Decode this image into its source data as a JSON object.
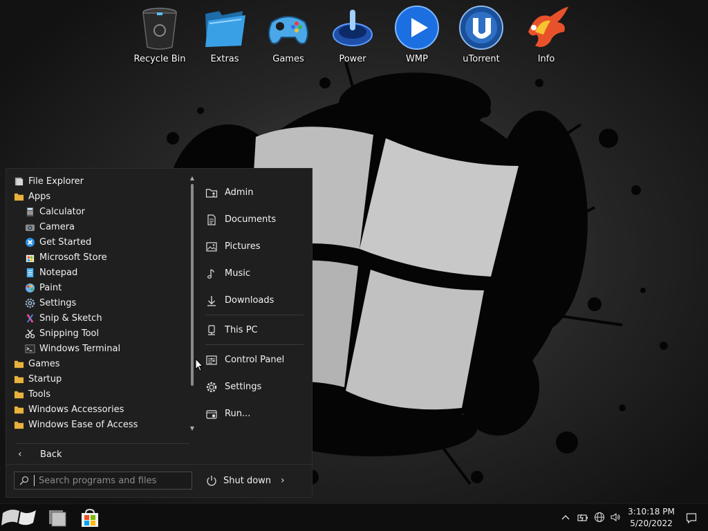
{
  "desktop": {
    "icons": [
      {
        "label": "Recycle Bin",
        "icon": "recycle-bin-icon"
      },
      {
        "label": "Extras",
        "icon": "folder-icon"
      },
      {
        "label": "Games",
        "icon": "gamepad-icon"
      },
      {
        "label": "Power",
        "icon": "power-icon"
      },
      {
        "label": "WMP",
        "icon": "play-icon"
      },
      {
        "label": "uTorrent",
        "icon": "utorrent-icon"
      },
      {
        "label": "Info",
        "icon": "phoenix-icon"
      }
    ]
  },
  "start_menu": {
    "tree": [
      {
        "label": "File Explorer",
        "icon": "file-explorer-icon"
      },
      {
        "label": "Apps",
        "icon": "folder-icon"
      },
      {
        "label": "Calculator",
        "icon": "calculator-icon"
      },
      {
        "label": "Camera",
        "icon": "camera-icon"
      },
      {
        "label": "Get Started",
        "icon": "get-started-icon"
      },
      {
        "label": "Microsoft Store",
        "icon": "store-icon"
      },
      {
        "label": "Notepad",
        "icon": "notepad-icon"
      },
      {
        "label": "Paint",
        "icon": "paint-icon"
      },
      {
        "label": "Settings",
        "icon": "gear-icon"
      },
      {
        "label": "Snip & Sketch",
        "icon": "snip-sketch-icon"
      },
      {
        "label": "Snipping Tool",
        "icon": "scissors-icon"
      },
      {
        "label": "Windows Terminal",
        "icon": "terminal-icon"
      },
      {
        "label": "Games",
        "icon": "folder-icon"
      },
      {
        "label": "Startup",
        "icon": "folder-icon"
      },
      {
        "label": "Tools",
        "icon": "folder-icon"
      },
      {
        "label": "Windows Accessories",
        "icon": "folder-icon"
      },
      {
        "label": "Windows Ease of Access",
        "icon": "folder-icon"
      }
    ],
    "places": [
      {
        "label": "Admin",
        "icon": "user-folder-icon"
      },
      {
        "label": "Documents",
        "icon": "document-icon"
      },
      {
        "label": "Pictures",
        "icon": "picture-icon"
      },
      {
        "label": "Music",
        "icon": "music-icon"
      },
      {
        "label": "Downloads",
        "icon": "download-icon"
      },
      {
        "label": "This PC",
        "icon": "computer-icon"
      },
      {
        "label": "Control Panel",
        "icon": "control-panel-icon"
      },
      {
        "label": "Settings",
        "icon": "gear-icon"
      },
      {
        "label": "Run...",
        "icon": "run-icon"
      }
    ],
    "back_label": "Back",
    "search_placeholder": "Search programs and files",
    "shutdown_label": "Shut down"
  },
  "taskbar": {
    "pinned": [
      "start-orb-icon",
      "file-explorer-icon",
      "store-icon"
    ],
    "tray": [
      "chevron-up-icon",
      "battery-icon",
      "network-icon",
      "volume-icon"
    ],
    "time": "3:10:18 PM",
    "date": "5/20/2022"
  },
  "colors": {
    "folder": "#e8b23c",
    "menu_bg": "#1f1f1f",
    "taskbar_bg": "#0e0e0e"
  }
}
